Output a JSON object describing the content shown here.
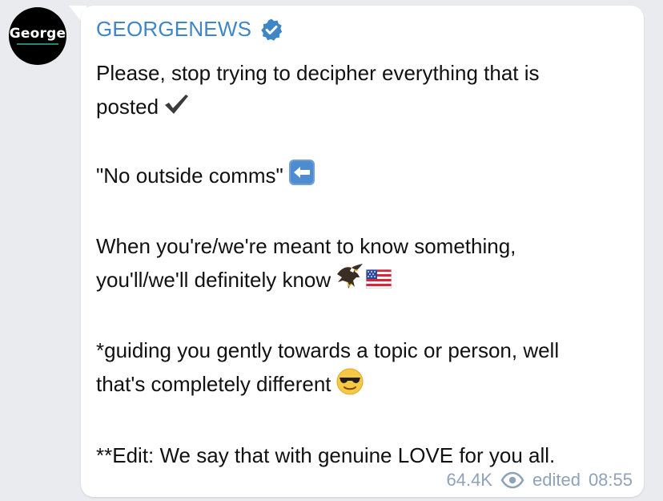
{
  "channel": {
    "avatar_text": "George",
    "name": "GEORGENEWS",
    "verified_icon": "verified-badge-icon",
    "accent_color": "#3e86c6"
  },
  "message": {
    "lines": [
      "Please, stop trying to decipher everything that is",
      "posted",
      "",
      "\"No outside comms\"",
      "",
      "When you're/we're meant to know something,",
      "you'll/we'll definitely know",
      "",
      "*guiding you gently towards a topic or person, well",
      "that's completely different",
      "",
      "**Edit: We say that with genuine LOVE for you all."
    ],
    "emojis": {
      "checkmark": "heavy-check-mark-icon",
      "left_arrow": "left-arrow-icon",
      "eagle": "eagle-icon",
      "flag": "us-flag-icon",
      "sunglasses": "sunglasses-face-icon"
    }
  },
  "footer": {
    "views": "64.4K",
    "views_icon": "eye-icon",
    "edited_label": "edited",
    "time": "08:55",
    "meta_color": "#8fa3b8"
  }
}
